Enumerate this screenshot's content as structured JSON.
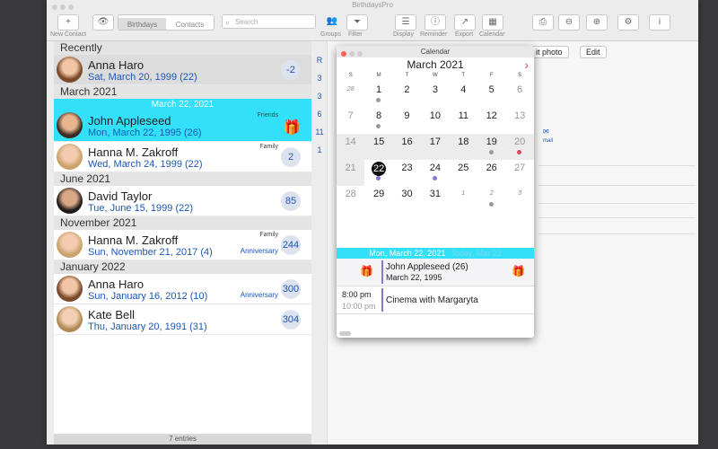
{
  "app": {
    "title": "BirthdaysPro"
  },
  "toolbar": {
    "new_contact": "New Contact",
    "tabs": [
      "Birthdays",
      "Contacts"
    ],
    "search_placeholder": "Search",
    "groups": "Groups",
    "filter": "Filter",
    "display": "Display",
    "reminder": "Reminder",
    "export": "Export",
    "calendar": "Calendar"
  },
  "list": {
    "sections": [
      {
        "title": "Recently",
        "rows": [
          {
            "name": "Anna Haro",
            "date": "Sat, March 20, 1999 (22)",
            "badge": "-2",
            "tag": "",
            "annotation": "",
            "style": "gray"
          }
        ]
      },
      {
        "title": "March 2021",
        "date_strip": "March 22, 2021",
        "rows": [
          {
            "name": "John Appleseed",
            "date": "Mon, March 22, 1995 (26)",
            "badge": "",
            "tag": "Friends",
            "annotation": "",
            "style": "sel"
          },
          {
            "name": "Hanna M. Zakroff",
            "date": "Wed, March 24, 1999 (22)",
            "badge": "2",
            "tag": "Family",
            "annotation": "",
            "style": ""
          }
        ]
      },
      {
        "title": "June 2021",
        "rows": [
          {
            "name": "David Taylor",
            "date": "Tue, June 15, 1999 (22)",
            "badge": "85",
            "tag": "",
            "annotation": "",
            "style": ""
          }
        ]
      },
      {
        "title": "November 2021",
        "rows": [
          {
            "name": "Hanna M. Zakroff",
            "date": "Sun, November 21, 2017 (4)",
            "badge": "244",
            "tag": "Family",
            "annotation": "Anniversary",
            "style": ""
          }
        ]
      },
      {
        "title": "January 2022",
        "rows": [
          {
            "name": "Anna Haro",
            "date": "Sun, January 16, 2012 (10)",
            "badge": "300",
            "tag": "",
            "annotation": "Anniversary",
            "style": ""
          },
          {
            "name": "Kate Bell",
            "date": "Thu, January 20, 1991 (31)",
            "badge": "304",
            "tag": "",
            "annotation": "",
            "style": ""
          }
        ]
      }
    ],
    "entries": "7 entries"
  },
  "index": [
    "R",
    "3",
    "3",
    "6",
    "11",
    "1"
  ],
  "detail": {
    "edit_photo": "it photo",
    "edit": "Edit",
    "mail": "mail"
  },
  "calendar": {
    "title": "Calendar",
    "month": "March 2021",
    "weekdays": [
      "S",
      "M",
      "T",
      "W",
      "T",
      "F",
      "S"
    ],
    "weeks": [
      [
        "28",
        "1",
        "2",
        "3",
        "4",
        "5",
        "6"
      ],
      [
        "7",
        "8",
        "9",
        "10",
        "11",
        "12",
        "13"
      ],
      [
        "14",
        "15",
        "16",
        "17",
        "18",
        "19",
        "20"
      ],
      [
        "21",
        "22",
        "23",
        "24",
        "25",
        "26",
        "27"
      ],
      [
        "28",
        "29",
        "30",
        "31",
        "1",
        "2",
        "3"
      ]
    ],
    "selected_date": "Mon, March 22, 2021",
    "selected_suffix": "Today, Mar 22",
    "events": [
      {
        "title": "John Appleseed (26)",
        "subtitle": "March 22, 1995",
        "time1": "",
        "time2": ""
      },
      {
        "title": "Cinema with Margaryta",
        "subtitle": "",
        "time1": "8:00 pm",
        "time2": "10:00 pm"
      }
    ]
  },
  "colors": {
    "accent_cyan": "#33e0fa",
    "link_blue": "#1b57b5",
    "event_purple": "#7d7bd6",
    "alert_red": "#e0475a"
  }
}
